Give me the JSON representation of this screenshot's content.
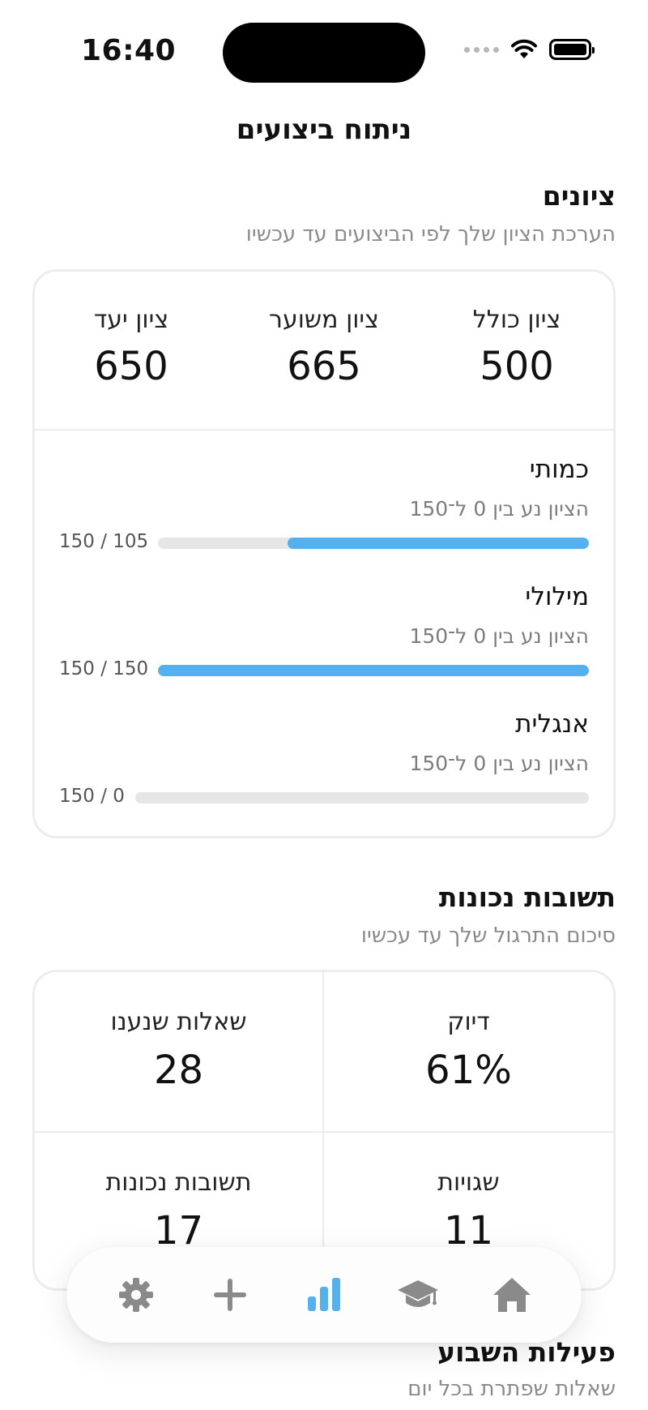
{
  "status_bar": {
    "time": "16:40"
  },
  "header": {
    "title": "ניתוח ביצועים"
  },
  "scores": {
    "title": "ציונים",
    "subtitle": "הערכת הציון שלך לפי הביצועים עד עכשיו",
    "summary": [
      {
        "label": "ציון כולל",
        "value": "500"
      },
      {
        "label": "ציון משוער",
        "value": "665"
      },
      {
        "label": "ציון יעד",
        "value": "650"
      }
    ],
    "subjects": [
      {
        "name": "כמותי",
        "range": "הציון נע בין 0 ל־150",
        "count": "150 / 105",
        "progress": 0.7
      },
      {
        "name": "מילולי",
        "range": "הציון נע בין 0 ל־150",
        "count": "150 / 150",
        "progress": 1.0
      },
      {
        "name": "אנגלית",
        "range": "הציון נע בין 0 ל־150",
        "count": "150 / 0",
        "progress": 0.0
      }
    ]
  },
  "accuracy": {
    "title": "תשובות נכונות",
    "subtitle": "סיכום התרגול שלך עד עכשיו",
    "stats": [
      {
        "label": "דיוק",
        "value": "61%"
      },
      {
        "label": "שאלות שנענו",
        "value": "28"
      },
      {
        "label": "שגויות",
        "value": "11"
      },
      {
        "label": "תשובות נכונות",
        "value": "17"
      }
    ]
  },
  "weekly": {
    "title": "פעילות השבוע",
    "subtitle": "שאלות שפתרת בכל יום"
  },
  "tabbar": {
    "active": "stats",
    "accent": "#55b0ee",
    "inactive": "#8a8a8a",
    "tabs": [
      "settings-icon",
      "plus-icon",
      "stats-icon",
      "graduation-cap-icon",
      "home-icon"
    ]
  }
}
